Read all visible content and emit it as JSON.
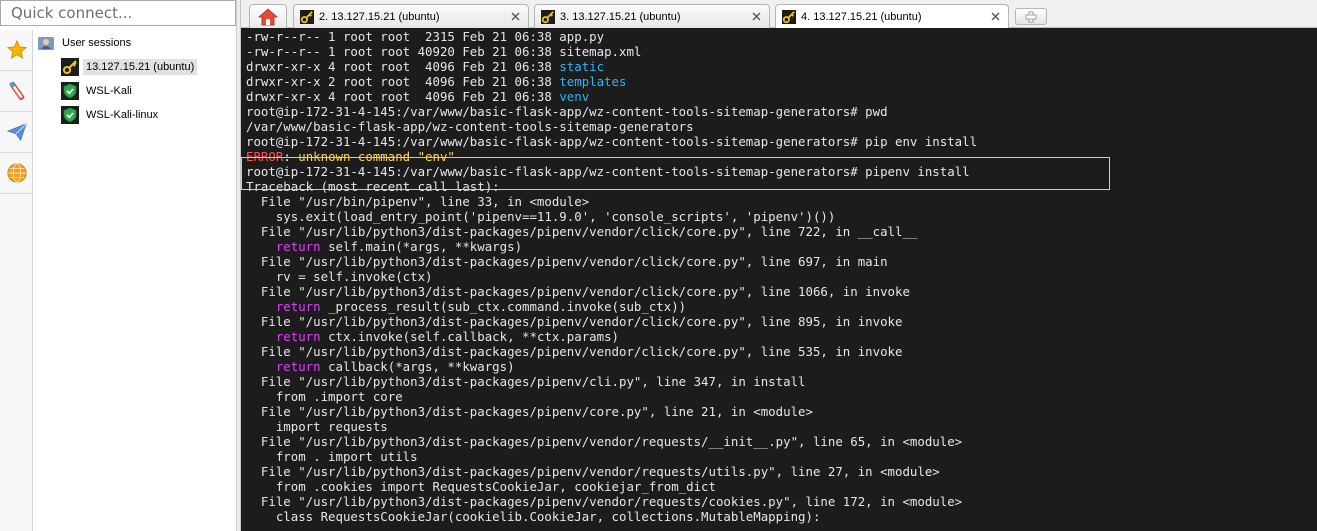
{
  "quick_connect": {
    "placeholder": "Quick connect..."
  },
  "side_toolbar": {
    "buttons": [
      {
        "icon": "star-icon",
        "color": "#f5b400"
      },
      {
        "icon": "tools-icon",
        "color": "#d84a3a"
      },
      {
        "icon": "send-icon",
        "color": "#5b8fd6"
      },
      {
        "icon": "globe-icon",
        "color": "#f0a020"
      }
    ]
  },
  "sessions": {
    "root_label": "User sessions",
    "items": [
      {
        "label": "13.127.15.21 (ubuntu)",
        "icon": "key-icon",
        "selected": true
      },
      {
        "label": "WSL-Kali",
        "icon": "shield-icon",
        "selected": false
      },
      {
        "label": "WSL-Kali-linux",
        "icon": "shield-icon",
        "selected": false
      }
    ]
  },
  "tabs": [
    {
      "label": "2. 13.127.15.21 (ubuntu)",
      "active": false
    },
    {
      "label": "3. 13.127.15.21 (ubuntu)",
      "active": false
    },
    {
      "label": "4. 13.127.15.21 (ubuntu)",
      "active": true
    }
  ],
  "terminal": {
    "lines": [
      [
        {
          "t": "-rw-r--r-- 1 root root  2315 Feb 21 06:38 app.py"
        }
      ],
      [
        {
          "t": "-rw-r--r-- 1 root root 40920 Feb 21 06:38 sitemap.xml"
        }
      ],
      [
        {
          "t": "drwxr-xr-x 4 root root  4096 Feb 21 06:38 "
        },
        {
          "t": "static",
          "c": "dir"
        }
      ],
      [
        {
          "t": "drwxr-xr-x 2 root root  4096 Feb 21 06:38 "
        },
        {
          "t": "templates",
          "c": "dir"
        }
      ],
      [
        {
          "t": "drwxr-xr-x 4 root root  4096 Feb 21 06:38 "
        },
        {
          "t": "venv",
          "c": "dir"
        }
      ],
      [
        {
          "t": "root@ip-172-31-4-145:/var/www/basic-flask-app/wz-content-tools-sitemap-generators# pwd"
        }
      ],
      [
        {
          "t": "/var/www/basic-flask-app/wz-content-tools-sitemap-generators"
        }
      ],
      [
        {
          "t": "root@ip-172-31-4-145:/var/www/basic-flask-app/wz-content-tools-sitemap-generators# pip env install"
        }
      ],
      [
        {
          "t": "ERROR",
          "c": "err"
        },
        {
          "t": ": "
        },
        {
          "t": "unknown command \"env\"",
          "c": "warn"
        }
      ],
      [
        {
          "t": "root@ip-172-31-4-145:/var/www/basic-flask-app/wz-content-tools-sitemap-generators# pipenv install"
        }
      ],
      [
        {
          "t": "Traceback (most recent call last):"
        }
      ],
      [
        {
          "t": "  File \"/usr/bin/pipenv\", line 33, in <module>"
        }
      ],
      [
        {
          "t": "    sys.exit(load_entry_point('pipenv==11.9.0', 'console_scripts', 'pipenv')())"
        }
      ],
      [
        {
          "t": "  File \"/usr/lib/python3/dist-packages/pipenv/vendor/click/core.py\", line 722, in __call__"
        }
      ],
      [
        {
          "t": "    "
        },
        {
          "t": "return",
          "c": "kw"
        },
        {
          "t": " self.main(*args, **kwargs)"
        }
      ],
      [
        {
          "t": "  File \"/usr/lib/python3/dist-packages/pipenv/vendor/click/core.py\", line 697, in main"
        }
      ],
      [
        {
          "t": "    rv = self.invoke(ctx)"
        }
      ],
      [
        {
          "t": "  File \"/usr/lib/python3/dist-packages/pipenv/vendor/click/core.py\", line 1066, in invoke"
        }
      ],
      [
        {
          "t": "    "
        },
        {
          "t": "return",
          "c": "kw"
        },
        {
          "t": " _process_result(sub_ctx.command.invoke(sub_ctx))"
        }
      ],
      [
        {
          "t": "  File \"/usr/lib/python3/dist-packages/pipenv/vendor/click/core.py\", line 895, in invoke"
        }
      ],
      [
        {
          "t": "    "
        },
        {
          "t": "return",
          "c": "kw"
        },
        {
          "t": " ctx.invoke(self.callback, **ctx.params)"
        }
      ],
      [
        {
          "t": "  File \"/usr/lib/python3/dist-packages/pipenv/vendor/click/core.py\", line 535, in invoke"
        }
      ],
      [
        {
          "t": "    "
        },
        {
          "t": "return",
          "c": "kw"
        },
        {
          "t": " callback(*args, **kwargs)"
        }
      ],
      [
        {
          "t": "  File \"/usr/lib/python3/dist-packages/pipenv/cli.py\", line 347, in install"
        }
      ],
      [
        {
          "t": "    from .import core"
        }
      ],
      [
        {
          "t": "  File \"/usr/lib/python3/dist-packages/pipenv/core.py\", line 21, in <module>"
        }
      ],
      [
        {
          "t": "    import requests"
        }
      ],
      [
        {
          "t": "  File \"/usr/lib/python3/dist-packages/pipenv/vendor/requests/__init__.py\", line 65, in <module>"
        }
      ],
      [
        {
          "t": "    from . import utils"
        }
      ],
      [
        {
          "t": "  File \"/usr/lib/python3/dist-packages/pipenv/vendor/requests/utils.py\", line 27, in <module>"
        }
      ],
      [
        {
          "t": "    from .cookies import RequestsCookieJar, cookiejar_from_dict"
        }
      ],
      [
        {
          "t": "  File \"/usr/lib/python3/dist-packages/pipenv/vendor/requests/cookies.py\", line 172, in <module>"
        }
      ],
      [
        {
          "t": "    class RequestsCookieJar(cookielib.CookieJar, collections.MutableMapping):"
        }
      ]
    ],
    "colors": {
      "background": "#1c1c1c",
      "text": "#e6e6e6",
      "dir": "#29b6f6",
      "err": "#ff5252",
      "warn": "#ffd54f",
      "kw": "#e040fb",
      "highlight_border": "#e8d84a"
    }
  }
}
